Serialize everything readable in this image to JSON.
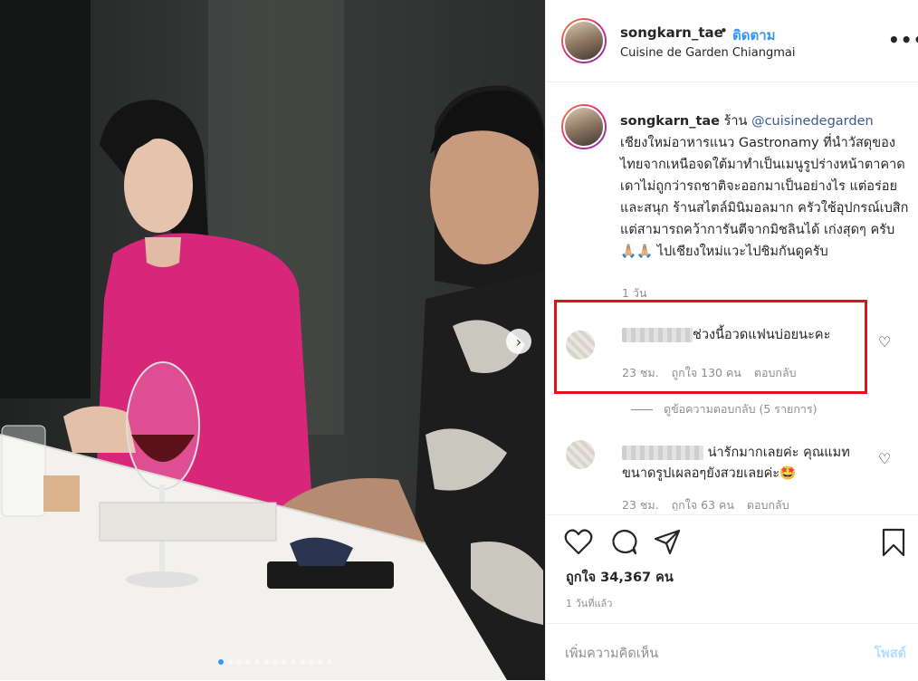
{
  "post": {
    "username": "songkarn_tae",
    "follow_label": "ติดตาม",
    "location": "Cuisine de Garden Chiangmai",
    "more_icon": "more-horizontal-icon",
    "caption_prefix": "ร้าน",
    "caption_mention": "@cuisinedegarden",
    "caption_body": "เชียงใหม่อาหารแนว Gastronamy ที่นำวัสดุของไทยจากเหนือจดใต้มาทำเป็นเมนูรูปร่างหน้าตาคาดเดาไม่ถูกว่ารถชาติจะออกมาเป็นอย่างไร แต่อร่อยและสนุก ร้านสไตล์มินิมอลมาก ครัวใช้อุปกรณ์เบสิก แต่สามารถคว้าการันตีจากมิชลินได้ เก่งสุดๆ ครับ🙏🏼🙏🏼 ไปเชียงใหม่แวะไปชิมกันดูครับ",
    "caption_time": "1 วัน",
    "likes_text": "ถูกใจ 34,367 คน",
    "posted_ago": "1 วันที่แล้ว",
    "comment_placeholder": "เพิ่มความคิดเห็น",
    "post_button": "โพสต์"
  },
  "comments": [
    {
      "text": "ช่วงนี้อวดแฟนบ่อยนะคะ",
      "time": "23 ชม.",
      "likes": "ถูกใจ 130 คน",
      "reply": "ตอบกลับ",
      "view_replies": "ดูข้อความตอบกลับ (5 รายการ)"
    },
    {
      "text": "น่ารักมากเลยค่ะ คุณแมทขนาดรูปเผลอๆยังสวยเลยค่ะ🤩",
      "time": "23 ชม.",
      "likes": "ถูกใจ 63 คน",
      "reply": "ตอบกลับ"
    }
  ],
  "icons": {
    "like": "heart-icon",
    "comment": "comment-icon",
    "share": "share-icon",
    "save": "bookmark-icon",
    "next": "chevron-right-icon"
  },
  "colors": {
    "link_blue": "#3897f0",
    "mention": "#3b5a8e",
    "highlight_box": "#d8161b",
    "muted": "#8e8e8e"
  }
}
